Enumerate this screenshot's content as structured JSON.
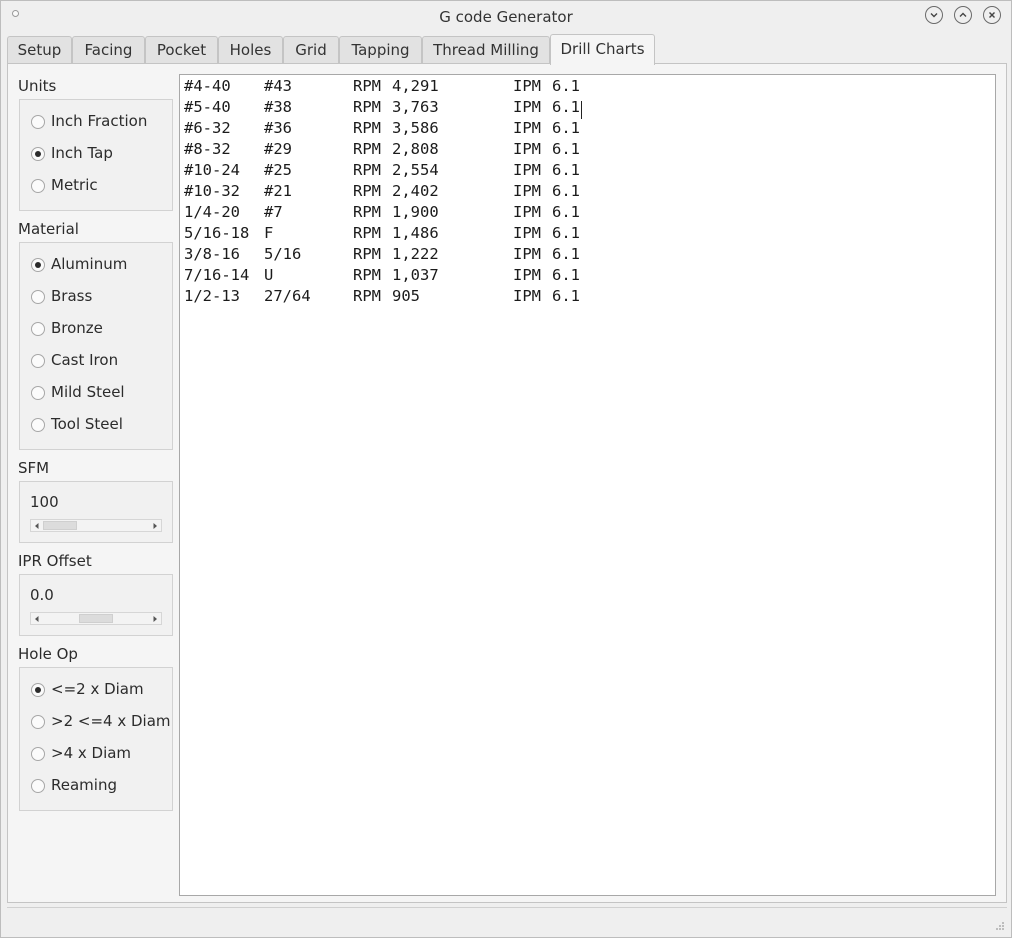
{
  "window": {
    "title": "G code Generator"
  },
  "tabs": [
    {
      "label": "Setup",
      "active": false
    },
    {
      "label": "Facing",
      "active": false
    },
    {
      "label": "Pocket",
      "active": false
    },
    {
      "label": "Holes",
      "active": false
    },
    {
      "label": "Grid",
      "active": false
    },
    {
      "label": "Tapping",
      "active": false
    },
    {
      "label": "Thread Milling",
      "active": false
    },
    {
      "label": "Drill Charts",
      "active": true
    }
  ],
  "units": {
    "label": "Units",
    "options": [
      {
        "label": "Inch Fraction",
        "selected": false
      },
      {
        "label": "Inch Tap",
        "selected": true
      },
      {
        "label": "Metric",
        "selected": false
      }
    ]
  },
  "material": {
    "label": "Material",
    "options": [
      {
        "label": "Aluminum",
        "selected": true
      },
      {
        "label": "Brass",
        "selected": false
      },
      {
        "label": "Bronze",
        "selected": false
      },
      {
        "label": "Cast Iron",
        "selected": false
      },
      {
        "label": "Mild Steel",
        "selected": false
      },
      {
        "label": "Tool Steel",
        "selected": false
      }
    ]
  },
  "sfm": {
    "label": "SFM",
    "value": "100",
    "slider_fraction": 0.0
  },
  "ipr_offset": {
    "label": "IPR Offset",
    "value": "0.0",
    "slider_fraction": 0.5
  },
  "hole_op": {
    "label": "Hole Op",
    "options": [
      {
        "label": "<=2 x Diam",
        "selected": true
      },
      {
        "label": ">2 <=4 x Diam",
        "selected": false
      },
      {
        "label": ">4 x Diam",
        "selected": false
      },
      {
        "label": "Reaming",
        "selected": false
      }
    ]
  },
  "drill_chart": {
    "rows": [
      {
        "tap": "#4-40",
        "drill": "#43",
        "rpm_label": "RPM",
        "rpm": "4,291",
        "ipm_label": "IPM",
        "ipm": "6.1"
      },
      {
        "tap": "#5-40",
        "drill": "#38",
        "rpm_label": "RPM",
        "rpm": "3,763",
        "ipm_label": "IPM",
        "ipm": "6.1"
      },
      {
        "tap": "#6-32",
        "drill": "#36",
        "rpm_label": "RPM",
        "rpm": "3,586",
        "ipm_label": "IPM",
        "ipm": "6.1"
      },
      {
        "tap": "#8-32",
        "drill": "#29",
        "rpm_label": "RPM",
        "rpm": "2,808",
        "ipm_label": "IPM",
        "ipm": "6.1"
      },
      {
        "tap": "#10-24",
        "drill": "#25",
        "rpm_label": "RPM",
        "rpm": "2,554",
        "ipm_label": "IPM",
        "ipm": "6.1"
      },
      {
        "tap": "#10-32",
        "drill": "#21",
        "rpm_label": "RPM",
        "rpm": "2,402",
        "ipm_label": "IPM",
        "ipm": "6.1"
      },
      {
        "tap": "1/4-20",
        "drill": "#7",
        "rpm_label": "RPM",
        "rpm": "1,900",
        "ipm_label": "IPM",
        "ipm": "6.1"
      },
      {
        "tap": "5/16-18",
        "drill": "F",
        "rpm_label": "RPM",
        "rpm": "1,486",
        "ipm_label": "IPM",
        "ipm": "6.1"
      },
      {
        "tap": "3/8-16",
        "drill": "5/16",
        "rpm_label": "RPM",
        "rpm": "1,222",
        "ipm_label": "IPM",
        "ipm": "6.1"
      },
      {
        "tap": "7/16-14",
        "drill": "U",
        "rpm_label": "RPM",
        "rpm": "1,037",
        "ipm_label": "IPM",
        "ipm": "6.1"
      },
      {
        "tap": "1/2-13",
        "drill": "27/64",
        "rpm_label": "RPM",
        "rpm": "905",
        "ipm_label": "IPM",
        "ipm": "6.1"
      }
    ]
  },
  "icons": [
    "app-menu-icon",
    "minimize-icon",
    "maximize-icon",
    "close-icon",
    "scroll-left-arrow-icon",
    "scroll-right-arrow-icon",
    "resize-grip-icon"
  ]
}
